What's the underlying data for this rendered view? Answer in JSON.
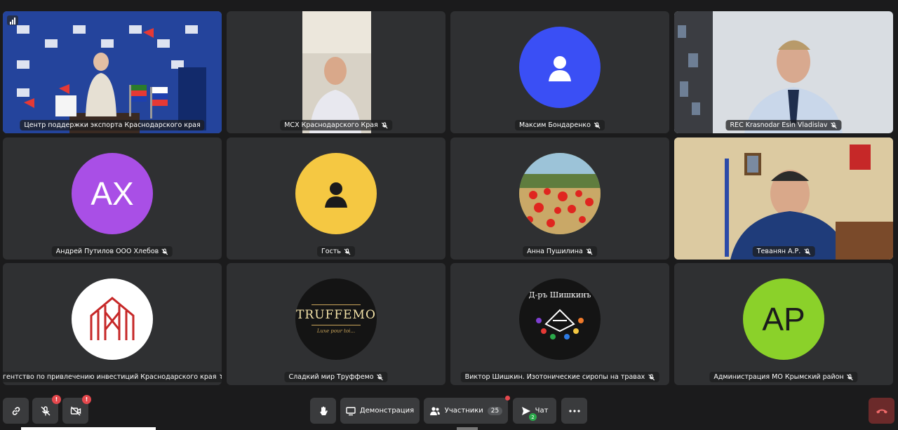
{
  "participants": [
    {
      "name": "Центр поддержки экспорта Краснодарского края",
      "kind": "video-conference-room",
      "active": true,
      "muted": false
    },
    {
      "name": "МСХ Краснодарского Края",
      "kind": "video-man-office",
      "muted": true
    },
    {
      "name": "Максим Бондаренко",
      "kind": "avatar-icon",
      "color": "#3a4ff5",
      "muted": true
    },
    {
      "name": "REC Krasnodar Esin Vladislav",
      "kind": "video-man-glasses",
      "muted": true
    },
    {
      "name": "Андрей Путилов ООО Хлебов",
      "kind": "avatar-initials",
      "initials": "АХ",
      "color": "#a94fe6",
      "muted": true
    },
    {
      "name": "Гость",
      "kind": "avatar-icon",
      "color": "#f5c842",
      "muted": true
    },
    {
      "name": "Анна Пушилина",
      "kind": "avatar-photo-poppies",
      "muted": true
    },
    {
      "name": "Теванян А.Р.",
      "kind": "video-official-office",
      "muted": true
    },
    {
      "name": "Агентство по привлечению инвестиций Краснодарского края",
      "kind": "logo-investment-agency",
      "muted": true
    },
    {
      "name": "Сладкий мир Труффемо",
      "kind": "logo-truffemo",
      "logo_text": "TRUFFEMO",
      "logo_sub": "Luxe pour toi...",
      "muted": true
    },
    {
      "name": "Виктор Шишкин. Изотонические сиропы на травах",
      "kind": "logo-shishkin",
      "logo_text": "Д-ръ Шишкинъ",
      "muted": true
    },
    {
      "name": "Администрация МО Крымский район",
      "kind": "avatar-initials",
      "initials": "АР",
      "color": "#8bd12a",
      "muted": true
    }
  ],
  "toolbar": {
    "link_icon": "link-icon",
    "mic_badge": "!",
    "cam_badge": "!",
    "raise_hand_icon": "hand-icon",
    "screen_share_label": "Демонстрация",
    "participants_label": "Участники",
    "participants_count": "25",
    "chat_label": "Чат",
    "chat_count": "2",
    "more_icon": "more-icon",
    "hangup_icon": "phone-hangup-icon"
  },
  "colors": {
    "background": "#1b1b1c",
    "tile": "#2f3032",
    "active_border": "#f5d547",
    "hangup": "#6b2a2a",
    "alert": "#e5484d"
  }
}
